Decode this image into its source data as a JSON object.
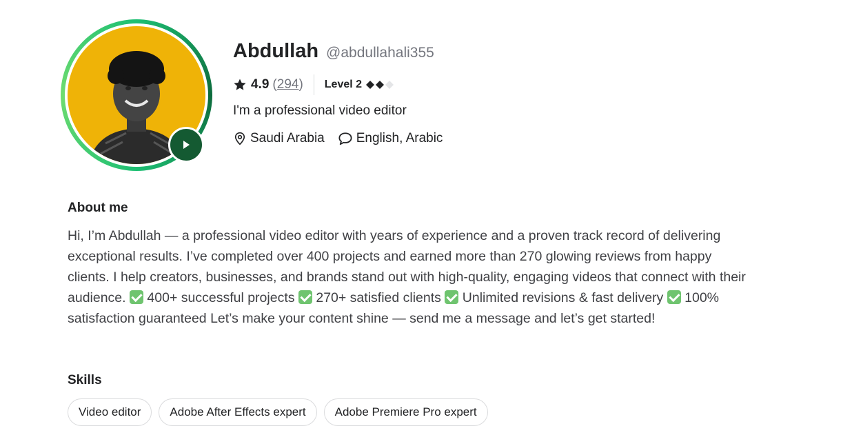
{
  "profile": {
    "name": "Abdullah",
    "username": "@abdullahali355",
    "rating": "4.9",
    "review_open": "(",
    "review_count": "294",
    "review_close": ")",
    "level": "Level 2",
    "level_filled": 2,
    "level_total": 3,
    "tagline": "I'm a professional video editor",
    "location": "Saudi Arabia",
    "languages": "English, Arabic",
    "icons": {
      "rating": "star-icon",
      "location": "location-pin-icon",
      "languages": "chat-bubble-icon",
      "video": "play-icon"
    },
    "colors": {
      "accent": "#1dbf73",
      "play_button": "#145a32",
      "avatar_bg": "#efb307",
      "check": "#6fc46f"
    }
  },
  "about": {
    "title": "About me",
    "intro": "Hi, I’m Abdullah — a professional video editor with years of experience and a proven track record of delivering exceptional results. I’ve completed over 400 projects and earned more than 270 glowing reviews from happy clients. I help creators, businesses, and brands stand out with high-quality, engaging videos that connect with their audience.",
    "points": [
      "400+ successful projects",
      "270+ satisfied clients",
      "Unlimited revisions & fast delivery",
      "100% satisfaction guaranteed"
    ],
    "outro": "Let’s make your content shine — send me a message and let’s get started!"
  },
  "skills": {
    "title": "Skills",
    "items": [
      "Video editor",
      "Adobe After Effects expert",
      "Adobe Premiere Pro expert"
    ]
  }
}
